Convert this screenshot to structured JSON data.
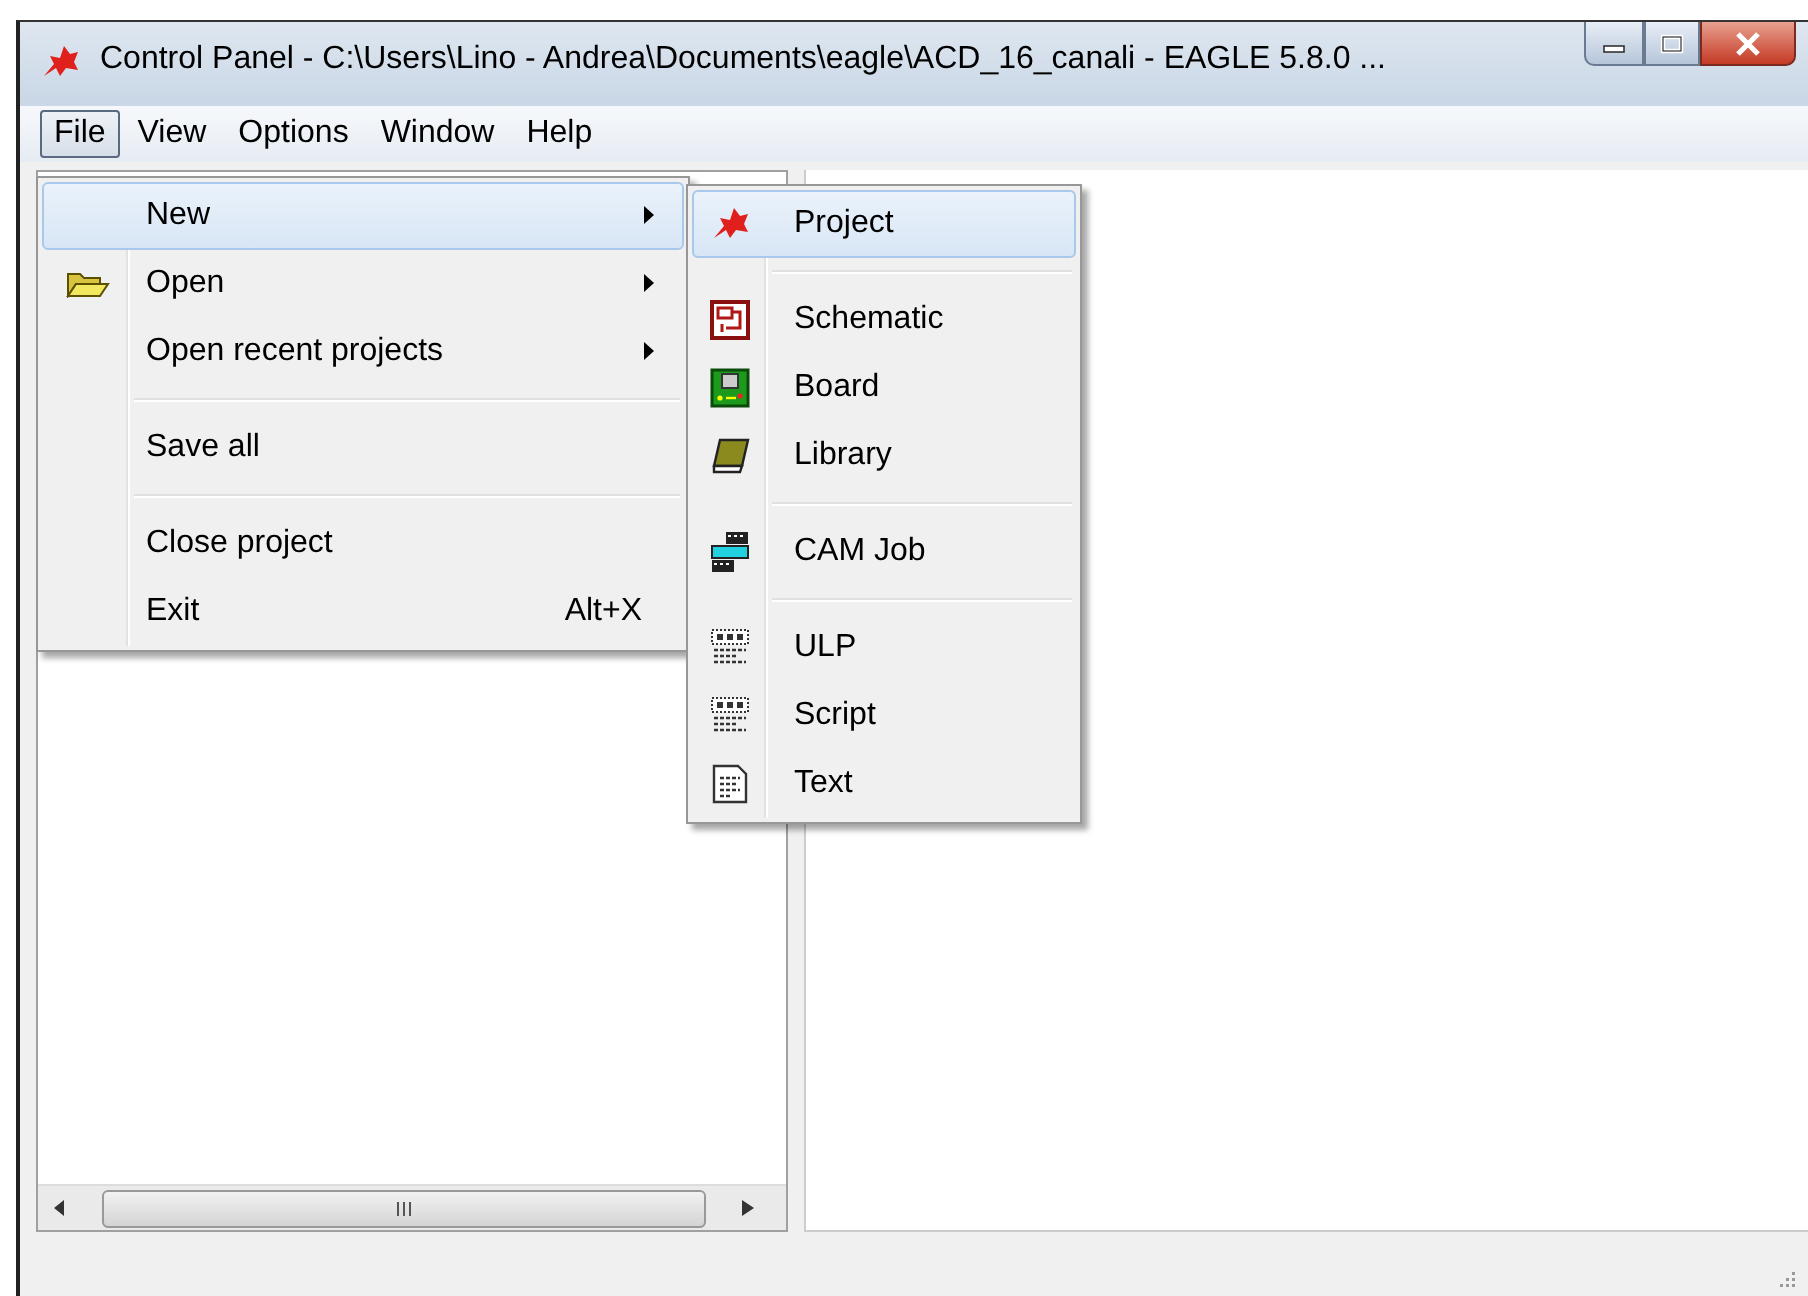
{
  "window": {
    "title": "Control Panel - C:\\Users\\Lino - Andrea\\Documents\\eagle\\ACD_16_canali - EAGLE 5.8.0 ..."
  },
  "menu_bar": [
    {
      "label": "File",
      "selected": true
    },
    {
      "label": "View",
      "selected": false
    },
    {
      "label": "Options",
      "selected": false
    },
    {
      "label": "Window",
      "selected": false
    },
    {
      "label": "Help",
      "selected": false
    }
  ],
  "file_menu": [
    {
      "kind": "item",
      "label": "New",
      "submenu": true,
      "selected": true
    },
    {
      "kind": "item",
      "label": "Open",
      "submenu": true,
      "selected": false
    },
    {
      "kind": "item",
      "label": "Open recent projects",
      "submenu": true,
      "selected": false
    },
    {
      "kind": "separator"
    },
    {
      "kind": "item",
      "label": "Save all",
      "submenu": false,
      "selected": false
    },
    {
      "kind": "separator"
    },
    {
      "kind": "item",
      "label": "Close project",
      "submenu": false,
      "selected": false
    },
    {
      "kind": "item",
      "label": "Exit",
      "shortcut": "Alt+X",
      "submenu": false,
      "selected": false
    }
  ],
  "new_submenu": [
    {
      "kind": "item",
      "label": "Project",
      "selected": true
    },
    {
      "kind": "separator"
    },
    {
      "kind": "item",
      "label": "Schematic",
      "selected": false
    },
    {
      "kind": "item",
      "label": "Board",
      "selected": false
    },
    {
      "kind": "item",
      "label": "Library",
      "selected": false
    },
    {
      "kind": "separator"
    },
    {
      "kind": "item",
      "label": "CAM Job",
      "selected": false
    },
    {
      "kind": "separator"
    },
    {
      "kind": "item",
      "label": "ULP",
      "selected": false
    },
    {
      "kind": "item",
      "label": "Script",
      "selected": false
    },
    {
      "kind": "item",
      "label": "Text",
      "selected": false
    }
  ]
}
